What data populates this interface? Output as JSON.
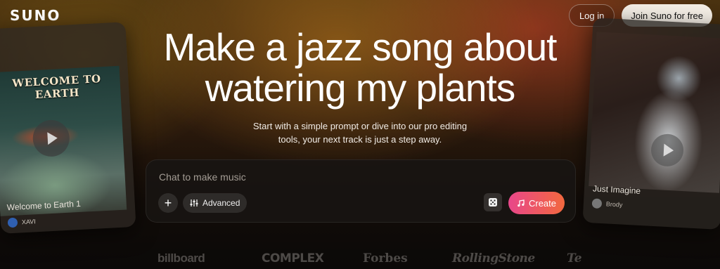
{
  "header": {
    "logo_text": "SUNO",
    "login_label": "Log in",
    "join_label": "Join Suno for free"
  },
  "hero": {
    "headline_line1": "Make a jazz song about",
    "headline_line2": "watering my plants",
    "subtitle_line1": "Start with a simple prompt or dive into our pro editing",
    "subtitle_line2": "tools, your next track is just a step away."
  },
  "cards": {
    "left": {
      "art_title": "WELCOME TO EARTH",
      "title": "Welcome to Earth 1",
      "user": "XAVI"
    },
    "right": {
      "title": "Just Imagine",
      "user": "Brody"
    }
  },
  "prompt": {
    "placeholder": "Chat to make music",
    "plus_label": "+",
    "advanced_label": "Advanced",
    "create_label": "Create"
  },
  "press": {
    "logos": [
      "billboard",
      "COMPLEX",
      "Forbes",
      "RollingStone",
      "Te"
    ]
  },
  "colors": {
    "create_gradient_start": "#e8478a",
    "create_gradient_end": "#f2683e",
    "join_bg": "#f3ede4"
  }
}
